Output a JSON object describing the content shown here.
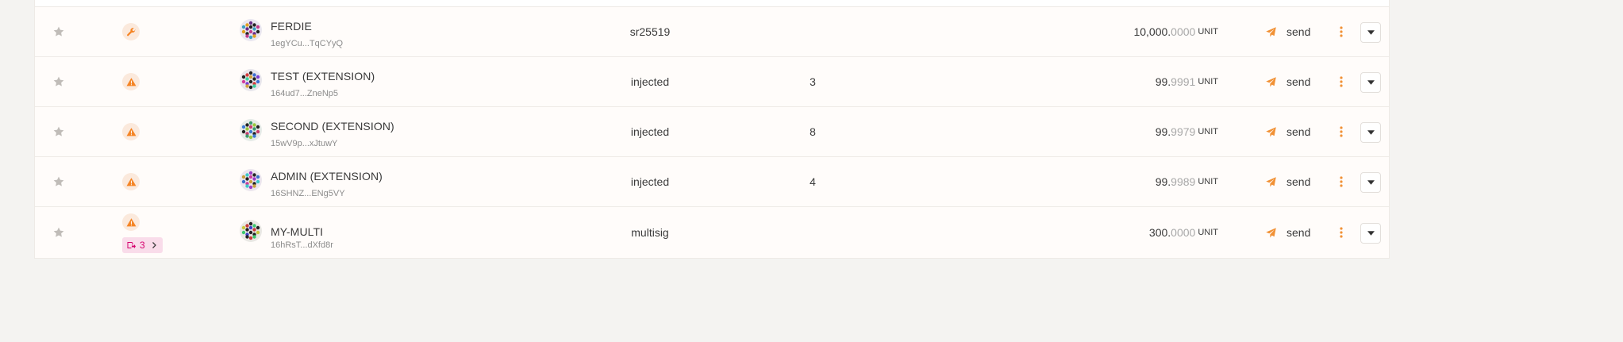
{
  "colors": {
    "accent": "#f19135",
    "warning": "#f58424",
    "proxy": "#d5006d",
    "star": "#c0bcb8"
  },
  "accounts": [
    {
      "badge_icon": "wrench-icon",
      "name": "FERDIE",
      "address": "1egYCu...TqCYyQ",
      "type": "sr25519",
      "count": "",
      "balance_int": "10,000.",
      "balance_dec": "0000",
      "unit": "UNIT",
      "send_label": "send"
    },
    {
      "badge_icon": "warning-icon",
      "name": "TEST (EXTENSION)",
      "address": "164ud7...ZneNp5",
      "type": "injected",
      "count": "3",
      "balance_int": "99.",
      "balance_dec": "9991",
      "unit": "UNIT",
      "send_label": "send"
    },
    {
      "badge_icon": "warning-icon",
      "name": "SECOND (EXTENSION)",
      "address": "15wV9p...xJtuwY",
      "type": "injected",
      "count": "8",
      "balance_int": "99.",
      "balance_dec": "9979",
      "unit": "UNIT",
      "send_label": "send"
    },
    {
      "badge_icon": "warning-icon",
      "name": "ADMIN (EXTENSION)",
      "address": "16SHNZ...ENg5VY",
      "type": "injected",
      "count": "4",
      "balance_int": "99.",
      "balance_dec": "9989",
      "unit": "UNIT",
      "send_label": "send"
    },
    {
      "badge_icon": "warning-icon",
      "proxy_count": "3",
      "name": "MY-MULTI",
      "address": "16hRsT...dXfd8r",
      "type": "multisig",
      "count": "",
      "balance_int": "300.",
      "balance_dec": "0000",
      "unit": "UNIT",
      "send_label": "send"
    }
  ]
}
